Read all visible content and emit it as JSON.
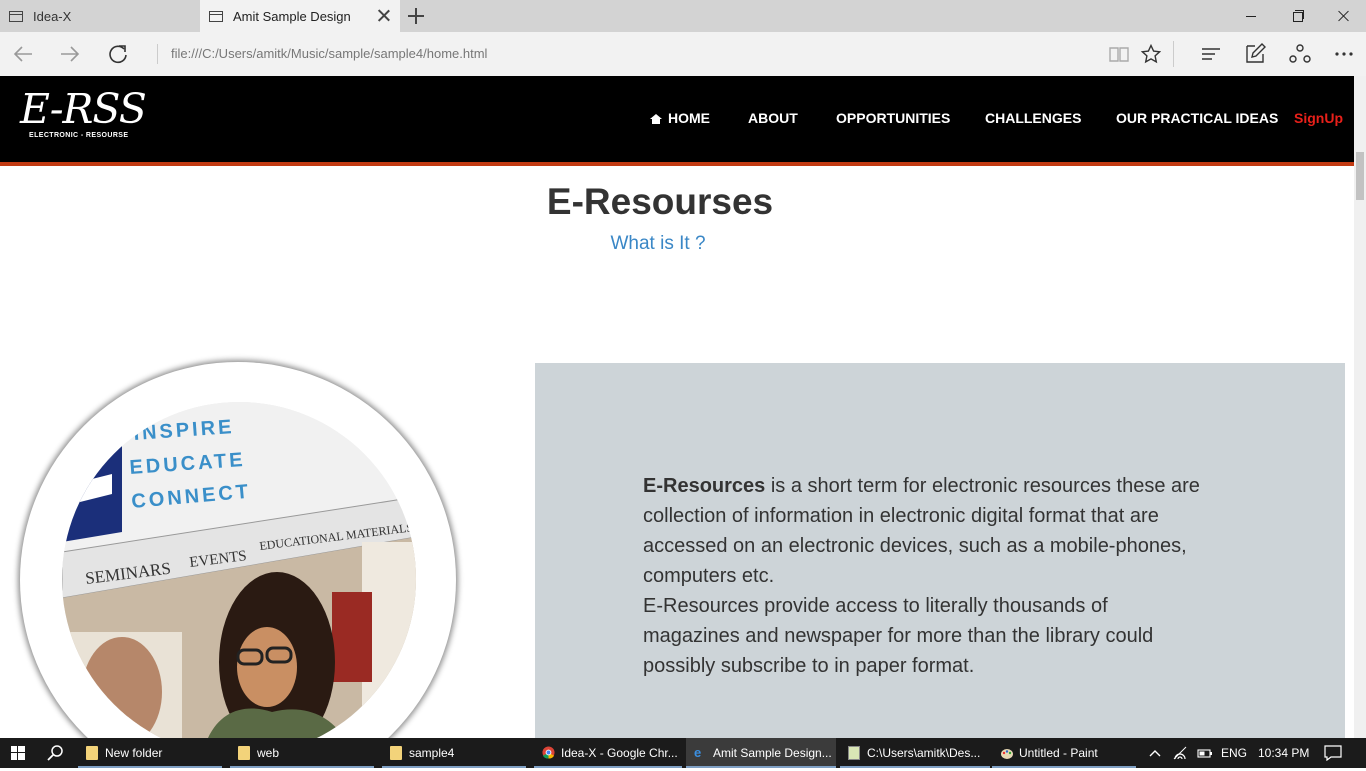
{
  "browser": {
    "tabs": [
      {
        "title": "Idea-X"
      },
      {
        "title": "Amit Sample Design"
      }
    ],
    "url": "file:///C:/Users/amitk/Music/sample/sample4/home.html"
  },
  "site": {
    "logo": {
      "main": "E-RSS",
      "sub": "ELECTRONIC - RESOURSE"
    },
    "menu": {
      "home": "HOME",
      "about": "ABOUT",
      "opportunities": "OPPORTUNITIES",
      "challenges": "CHALLENGES",
      "ideas": "OUR PRACTICAL IDEAS",
      "signup": "SignUp"
    },
    "heading": "E-Resourses",
    "subheading": "What is It ?",
    "photo_text": {
      "line1": "INSPIRE",
      "line2": "EDUCATE",
      "line3": "CONNECT",
      "nav1": "SEMINARS",
      "nav2": "EVENTS",
      "nav3": "EDUCATIONAL MATERIALS"
    },
    "info": {
      "bold_term": "E-Resources",
      "para1_rest": " is a short term for electronic resources these are collection of information in electronic digital format that are accessed on an electronic devices, such as a mobile-phones, computers etc.",
      "para2": "E-Resources provide access to literally thousands of magazines and newspaper for more than the library could possibly subscribe to in paper format."
    },
    "colors": {
      "header_bg": "#000000",
      "accent_bar": "#c23a12",
      "signup": "#e8201a",
      "subheading": "#3a87c6",
      "info_bg": "#cdd4d8"
    }
  },
  "taskbar": {
    "items": [
      {
        "label": "New folder"
      },
      {
        "label": "web"
      },
      {
        "label": "sample4"
      },
      {
        "label": "Idea-X - Google Chr..."
      },
      {
        "label": "Amit Sample Design..."
      },
      {
        "label": "C:\\Users\\amitk\\Des..."
      },
      {
        "label": "Untitled - Paint"
      }
    ],
    "language": "ENG",
    "time": "10:34 PM"
  }
}
